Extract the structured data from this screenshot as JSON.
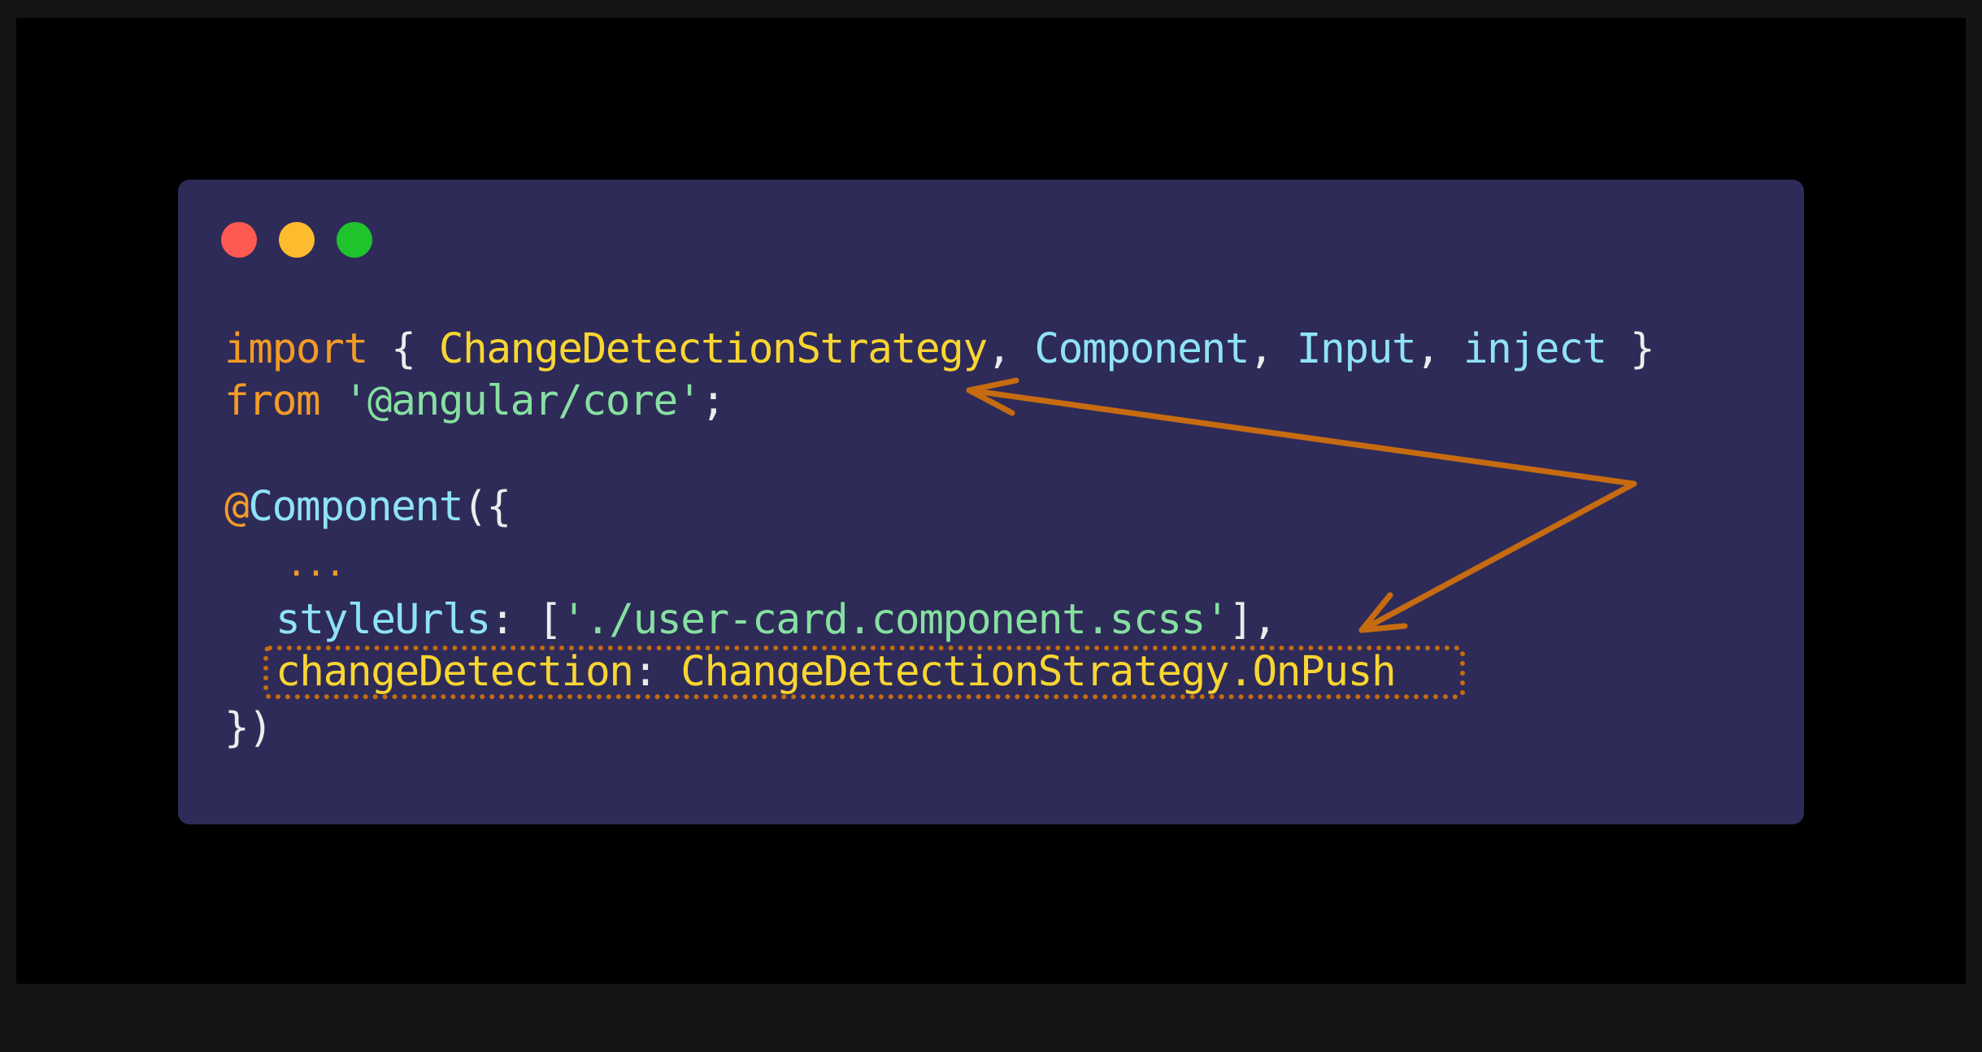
{
  "window_controls": {
    "close": "red-dot",
    "minimize": "yellow-dot",
    "maximize": "green-dot"
  },
  "code": {
    "line1": {
      "import": "import",
      "brace_open": " { ",
      "type1": "ChangeDetectionStrategy",
      "sep1": ", ",
      "type2": "Component",
      "sep2": ", ",
      "type3": "Input",
      "sep3": ", ",
      "type4": "inject",
      "brace_close": " }"
    },
    "line2": {
      "from": "from",
      "space": " ",
      "module": "'@angular/core'",
      "semicolon": ";"
    },
    "line3": {
      "at": "@",
      "decorator": "Component",
      "open": "({"
    },
    "line4": {
      "ellipsis": "..."
    },
    "line5": {
      "key": "styleUrls",
      "colon": ": [",
      "value": "'./user-card.component.scss'",
      "end": "],"
    },
    "line6": {
      "key": "changeDetection",
      "colon": ": ",
      "value": "ChangeDetectionStrategy.OnPush"
    },
    "line7": {
      "close": "})"
    }
  },
  "colors": {
    "background": "#2e2b58",
    "keyword": "#f29b27",
    "type": "#f8d531",
    "identifier": "#8fe2f5",
    "string": "#86e0a0",
    "annotation": "#c76b11"
  },
  "annotation": {
    "highlight_icon": "dotted-highlight-box",
    "arrow_icon": "double-headed-arrow"
  }
}
